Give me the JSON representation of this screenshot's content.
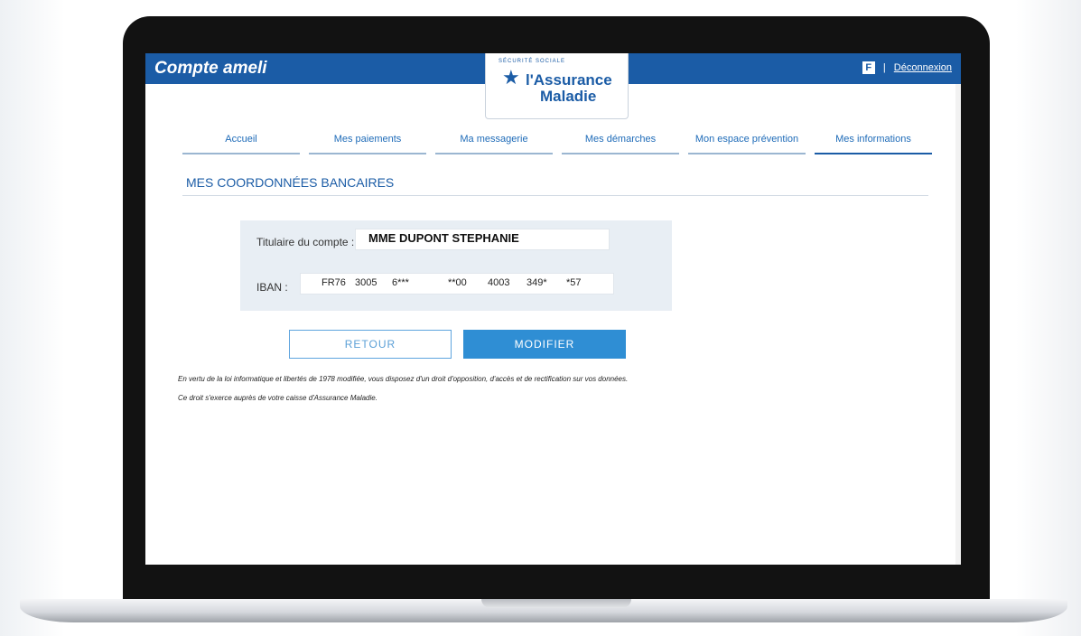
{
  "header": {
    "brand": "Compte ameli",
    "logo_line1": "l'Assurance",
    "logo_line2": "Maladie",
    "logo_arc_text": "SÉCURITÉ SOCIALE",
    "logout_icon": "F",
    "separator": "|",
    "logout_label": "Déconnexion"
  },
  "nav": {
    "tabs": [
      {
        "label": "Accueil"
      },
      {
        "label": "Mes paiements"
      },
      {
        "label": "Ma messagerie"
      },
      {
        "label": "Mes démarches"
      },
      {
        "label": "Mon espace prévention"
      },
      {
        "label": "Mes informations",
        "active": true
      }
    ]
  },
  "section": {
    "title": "MES COORDONNÉES BANCAIRES"
  },
  "form": {
    "holder_label": "Titulaire du compte :",
    "holder_value": "MME DUPONT STEPHANIE",
    "iban_label": "IBAN :",
    "iban_parts": [
      "FR76",
      "3005",
      "6***",
      "**00",
      "4003",
      "349*",
      "*57"
    ]
  },
  "buttons": {
    "back": "RETOUR",
    "edit": "MODIFIER"
  },
  "legal": {
    "line1": "En vertu de la loi informatique et libertés de 1978 modifiée, vous disposez d'un droit d'opposition, d'accès et de rectification sur vos données.",
    "line2": "Ce droit s'exerce auprès de votre caisse d'Assurance Maladie."
  },
  "colors": {
    "brand_blue": "#1b5ca6",
    "button_blue": "#2f8ed4",
    "panel_bg": "#e8eef4"
  },
  "icons": {
    "logout": "logout-icon",
    "logo": "assurance-maladie-logo"
  }
}
